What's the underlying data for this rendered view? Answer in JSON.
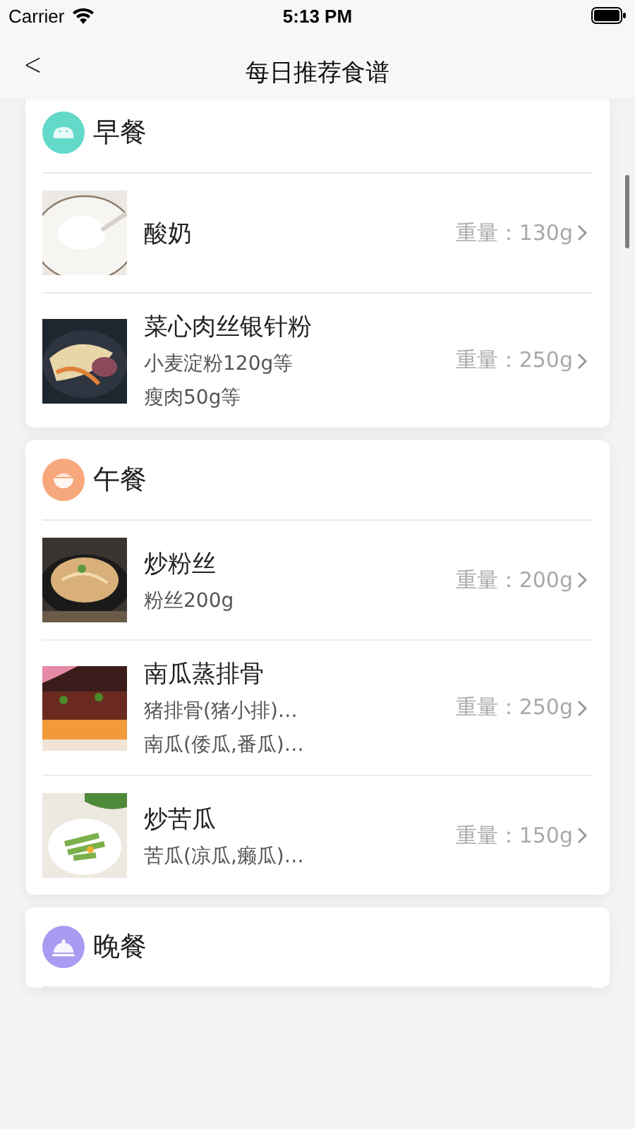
{
  "status_bar": {
    "carrier": "Carrier",
    "time": "5:13 PM"
  },
  "nav_bar": {
    "back": "<",
    "title": "每日推荐食谱"
  },
  "meals": [
    {
      "title": "早餐",
      "color": "#62d9c9",
      "items": [
        {
          "name": "酸奶",
          "weight": "重量：130g",
          "picture": {
            "kind": "picture"
          }
        },
        {
          "name": "菜心肉丝银针粉",
          "ingredients": [
            "小麦淀粉120g等",
            "瘦肉50g等"
          ],
          "weight": "重量：250g",
          "picture": {
            "kind": "picture"
          }
        }
      ]
    },
    {
      "title": "午餐",
      "color": "#f7a77c",
      "items": [
        {
          "name": "炒粉丝",
          "ingredients": [
            "粉丝200g"
          ],
          "weight": "重量：200g",
          "picture": {
            "kind": "picture"
          }
        },
        {
          "name": "南瓜蒸排骨",
          "ingredients": [
            "猪排骨(猪小排)…",
            "南瓜(倭瓜,番瓜)…"
          ],
          "weight": "重量：250g",
          "picture": {
            "kind": "picture"
          }
        },
        {
          "name": "炒苦瓜",
          "ingredients": [
            "苦瓜(凉瓜,癞瓜)…"
          ],
          "weight": "重量：150g",
          "picture": {
            "kind": "picture"
          }
        }
      ]
    },
    {
      "title": "晚餐",
      "color": "#a99bf1"
    }
  ]
}
